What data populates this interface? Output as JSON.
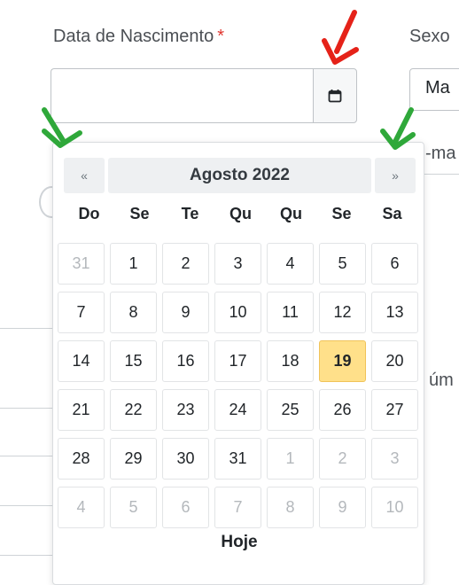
{
  "form": {
    "dob_label": "Data de Nascimento",
    "required_mark": "*",
    "dob_value": "",
    "sexo_label": "Sexo",
    "sexo_value": "Ma",
    "email_label": "-ma",
    "numero_label": "úm"
  },
  "datepicker": {
    "prev": "«",
    "next": "»",
    "title": "Agosto 2022",
    "weekdays": [
      "Do",
      "Se",
      "Te",
      "Qu",
      "Qu",
      "Se",
      "Sa"
    ],
    "days": [
      {
        "d": "31",
        "muted": true
      },
      {
        "d": "1"
      },
      {
        "d": "2"
      },
      {
        "d": "3"
      },
      {
        "d": "4"
      },
      {
        "d": "5"
      },
      {
        "d": "6"
      },
      {
        "d": "7"
      },
      {
        "d": "8"
      },
      {
        "d": "9"
      },
      {
        "d": "10"
      },
      {
        "d": "11"
      },
      {
        "d": "12"
      },
      {
        "d": "13"
      },
      {
        "d": "14"
      },
      {
        "d": "15"
      },
      {
        "d": "16"
      },
      {
        "d": "17"
      },
      {
        "d": "18"
      },
      {
        "d": "19",
        "today": true
      },
      {
        "d": "20"
      },
      {
        "d": "21"
      },
      {
        "d": "22"
      },
      {
        "d": "23"
      },
      {
        "d": "24"
      },
      {
        "d": "25"
      },
      {
        "d": "26"
      },
      {
        "d": "27"
      },
      {
        "d": "28"
      },
      {
        "d": "29"
      },
      {
        "d": "30"
      },
      {
        "d": "31"
      },
      {
        "d": "1",
        "muted": true
      },
      {
        "d": "2",
        "muted": true
      },
      {
        "d": "3",
        "muted": true
      },
      {
        "d": "4",
        "muted": true
      },
      {
        "d": "5",
        "muted": true
      },
      {
        "d": "6",
        "muted": true
      },
      {
        "d": "7",
        "muted": true
      },
      {
        "d": "8",
        "muted": true
      },
      {
        "d": "9",
        "muted": true
      },
      {
        "d": "10",
        "muted": true
      }
    ],
    "today_button": "Hoje"
  },
  "colors": {
    "required": "#e0362f",
    "today_highlight": "#ffe08a",
    "annotation_red": "#e52219",
    "annotation_green": "#2fa83a"
  },
  "icons": {
    "calendar": "calendar-icon",
    "annotation_red": "red-arrow-icon",
    "annotation_green": "green-arrow-icon"
  }
}
